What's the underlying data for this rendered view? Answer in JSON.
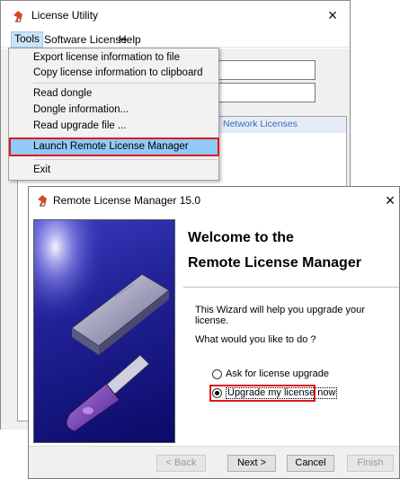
{
  "license_utility": {
    "title": "License Utility",
    "close_glyph": "×",
    "menu": [
      "Tools",
      "Software License",
      "Help"
    ],
    "panel_header": "Network Licenses",
    "tools_menu": {
      "export": "Export license information to file",
      "copy": "Copy license information to clipboard",
      "read_dongle": "Read dongle",
      "dongle_info": "Dongle information...",
      "read_upgrade": "Read upgrade file ...",
      "launch_rlm": "Launch Remote License Manager",
      "exit": "Exit"
    }
  },
  "remote_license_manager": {
    "title": "Remote License Manager 15.0",
    "close_glyph": "×",
    "heading_line1": "Welcome to the",
    "heading_line2": "Remote License Manager",
    "intro": "This Wizard will help you upgrade your license.",
    "question": "What would you like to do ?",
    "options": {
      "ask": "Ask for license upgrade",
      "upgrade_now": "Upgrade my license now"
    },
    "selected_option": "upgrade_now",
    "buttons": {
      "back": "< Back",
      "next": "Next >",
      "cancel": "Cancel",
      "finish": "Finish"
    }
  },
  "colors": {
    "highlight_box": "#e0181f",
    "menu_hover": "#91c9f7",
    "app_icon": "#d14a2a"
  },
  "icons": {
    "app_icon": "dongle-app-icon"
  }
}
